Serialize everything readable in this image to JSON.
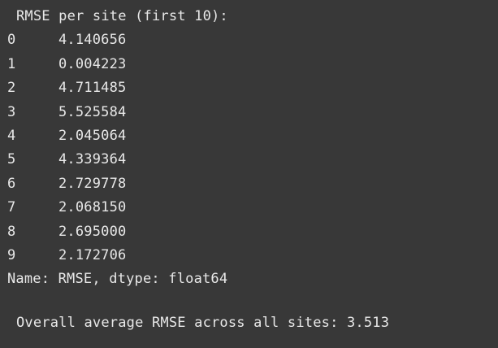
{
  "output": {
    "header": "RMSE per site (first 10):",
    "rows": [
      {
        "index": "0",
        "value": "4.140656"
      },
      {
        "index": "1",
        "value": "0.004223"
      },
      {
        "index": "2",
        "value": "4.711485"
      },
      {
        "index": "3",
        "value": "5.525584"
      },
      {
        "index": "4",
        "value": "2.045064"
      },
      {
        "index": "5",
        "value": "4.339364"
      },
      {
        "index": "6",
        "value": "2.729778"
      },
      {
        "index": "7",
        "value": "2.068150"
      },
      {
        "index": "8",
        "value": "2.695000"
      },
      {
        "index": "9",
        "value": "2.172706"
      }
    ],
    "footer": "Name: RMSE, dtype: float64",
    "summary": "Overall average RMSE across all sites: 3.513"
  },
  "colors": {
    "background": "#383838",
    "text": "#e8e8e8"
  }
}
